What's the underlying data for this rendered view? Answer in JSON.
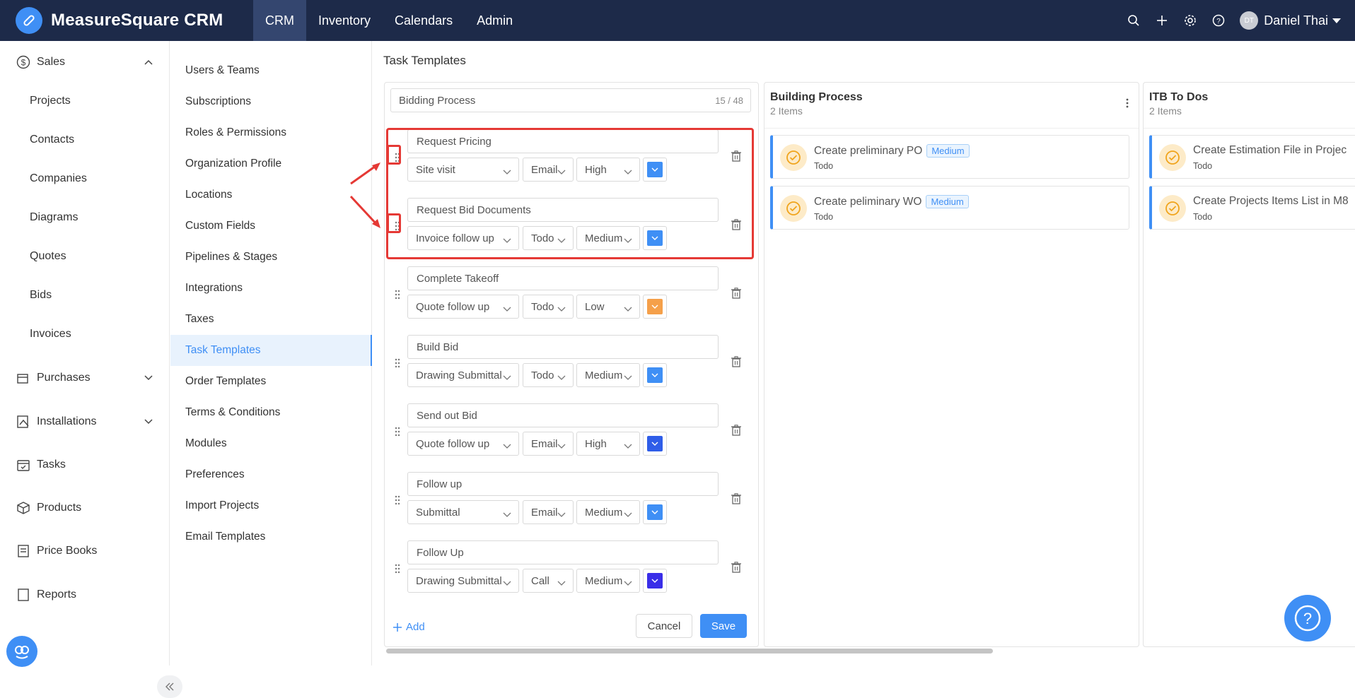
{
  "app": {
    "title": "MeasureSquare CRM"
  },
  "topnav": {
    "items": [
      "CRM",
      "Inventory",
      "Calendars",
      "Admin"
    ],
    "active": "CRM"
  },
  "user": {
    "initials": "DT",
    "name": "Daniel Thai"
  },
  "sidebar": {
    "sales": "Sales",
    "sales_items": [
      "Projects",
      "Contacts",
      "Companies",
      "Diagrams",
      "Quotes",
      "Bids",
      "Invoices"
    ],
    "purchases": "Purchases",
    "installations": "Installations",
    "tasks": "Tasks",
    "products": "Products",
    "price_books": "Price Books",
    "reports": "Reports"
  },
  "settings_menu": {
    "items": [
      "Users & Teams",
      "Subscriptions",
      "Roles & Permissions",
      "Organization Profile",
      "Locations",
      "Custom Fields",
      "Pipelines & Stages",
      "Integrations",
      "Taxes",
      "Task Templates",
      "Order Templates",
      "Terms & Conditions",
      "Modules",
      "Preferences",
      "Import Projects",
      "Email Templates"
    ],
    "active": "Task Templates"
  },
  "page": {
    "title": "Task Templates"
  },
  "editor": {
    "name": "Bidding Process",
    "counter": "15 / 48",
    "tasks": [
      {
        "name": "Request Pricing",
        "type": "Site visit",
        "action": "Email",
        "priority": "High",
        "color": "#3f8ff5"
      },
      {
        "name": "Request Bid Documents",
        "type": "Invoice follow up",
        "action": "Todo",
        "priority": "Medium",
        "color": "#3f8ff5"
      },
      {
        "name": "Complete Takeoff",
        "type": "Quote follow up",
        "action": "Todo",
        "priority": "Low",
        "color": "#f5a04a"
      },
      {
        "name": "Build Bid",
        "type": "Drawing Submittal",
        "action": "Todo",
        "priority": "Medium",
        "color": "#3f8ff5"
      },
      {
        "name": "Send out Bid",
        "type": "Quote follow up",
        "action": "Email",
        "priority": "High",
        "color": "#2f5de8"
      },
      {
        "name": "Follow up",
        "type": "Submittal",
        "action": "Email",
        "priority": "Medium",
        "color": "#3f8ff5"
      },
      {
        "name": "Follow Up",
        "type": "Drawing Submittal",
        "action": "Call",
        "priority": "Medium",
        "color": "#3a2ee8"
      }
    ],
    "add_label": "Add",
    "cancel_label": "Cancel",
    "save_label": "Save"
  },
  "columns": [
    {
      "title": "Building Process",
      "count": "2 Items",
      "cards": [
        {
          "title": "Create preliminary PO",
          "badge": "Medium",
          "status": "Todo"
        },
        {
          "title": "Create peliminary WO",
          "badge": "Medium",
          "status": "Todo"
        }
      ]
    },
    {
      "title": "ITB To Dos",
      "count": "2 Items",
      "cards": [
        {
          "title": "Create Estimation File in Projec",
          "status": "Todo"
        },
        {
          "title": "Create Projects Items List in M8",
          "status": "Todo"
        }
      ]
    }
  ],
  "colors": {
    "topbar": "#1d2a49",
    "accent": "#3f8ff5",
    "annotation": "#e53935"
  }
}
